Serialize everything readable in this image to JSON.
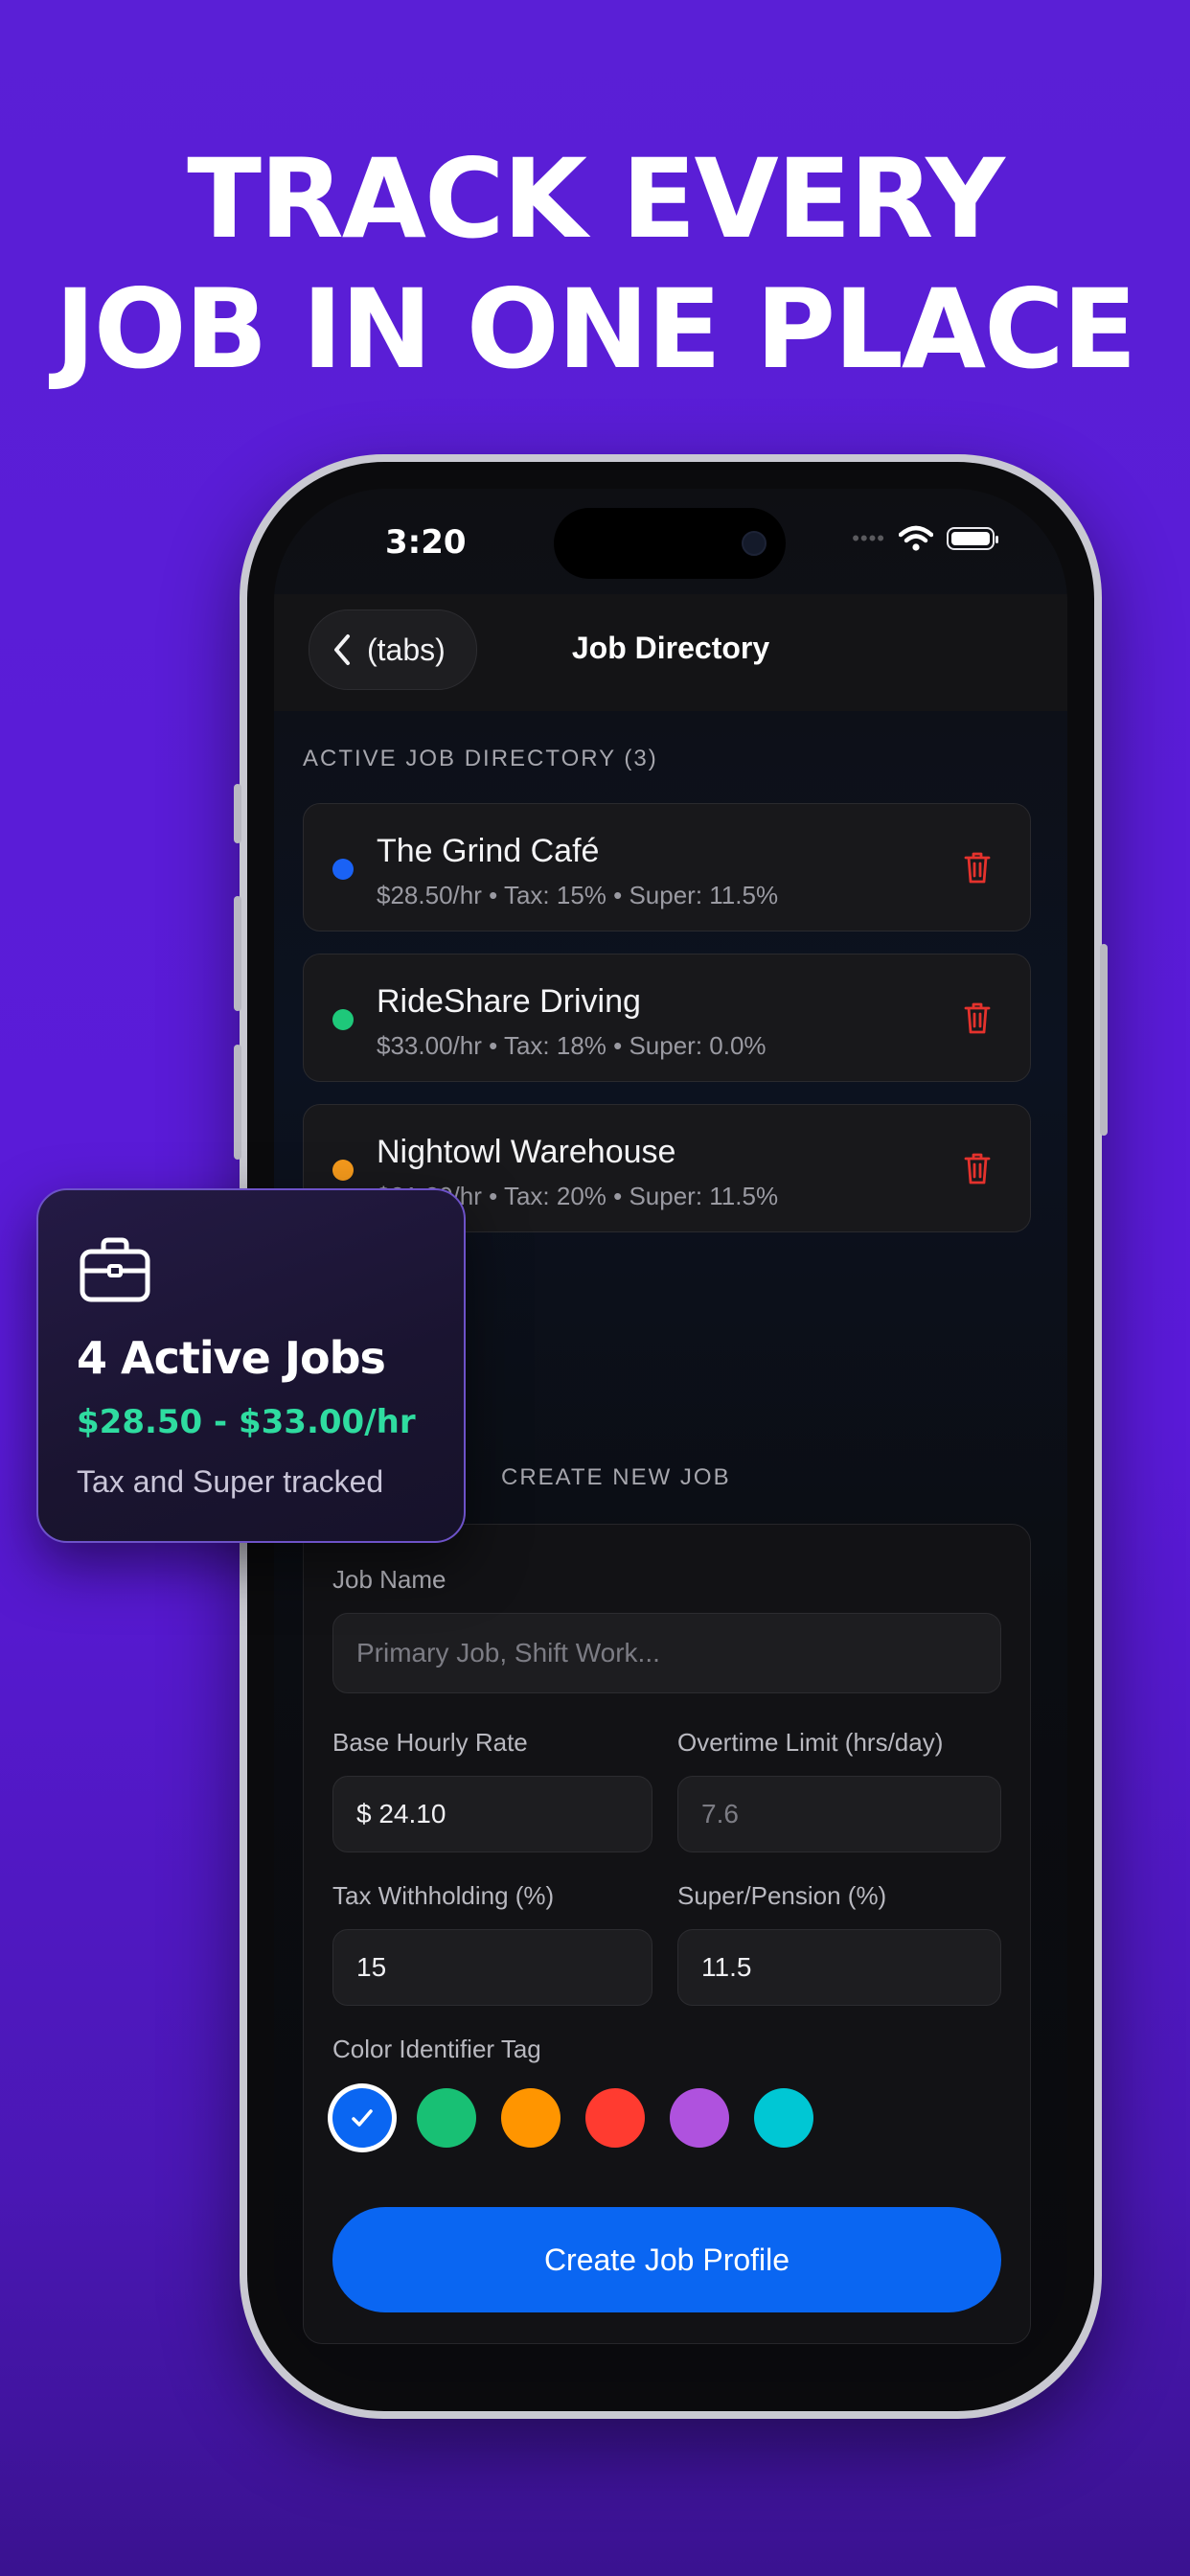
{
  "headline": {
    "line1": "TRACK EVERY",
    "line2": "JOB IN ONE PLACE"
  },
  "status_bar": {
    "time": "3:20",
    "signal": "••••"
  },
  "nav": {
    "back_label": "(tabs)",
    "title": "Job Directory"
  },
  "active_section": {
    "label": "ACTIVE JOB DIRECTORY (3)",
    "jobs": [
      {
        "name": "The Grind Café",
        "meta": "$28.50/hr • Tax: 15% • Super: 11.5%",
        "color": "#1a62f5"
      },
      {
        "name": "RideShare Driving",
        "meta": "$33.00/hr • Tax: 18% • Super: 0.0%",
        "color": "#1ec87a"
      },
      {
        "name": "Nightowl Warehouse",
        "meta": "$31.20/hr • Tax: 20% • Super: 11.5%",
        "color": "#f59a1c"
      }
    ]
  },
  "create_section": {
    "label": "CREATE NEW JOB",
    "job_name_label": "Job Name",
    "job_name_placeholder": "Primary Job, Shift Work...",
    "base_rate_label": "Base Hourly Rate",
    "base_rate_value": "$ 24.10",
    "overtime_label": "Overtime Limit (hrs/day)",
    "overtime_value": "7.6",
    "tax_label": "Tax Withholding (%)",
    "tax_value": "15",
    "super_label": "Super/Pension (%)",
    "super_value": "11.5",
    "color_label": "Color Identifier Tag",
    "colors": [
      "#0a66f2",
      "#18c074",
      "#ff9500",
      "#ff3b30",
      "#af52de",
      "#00c7d4"
    ],
    "selected_color_index": 0,
    "create_button": "Create Job Profile"
  },
  "summary_card": {
    "title": "4 Active Jobs",
    "range": "$28.50 - $33.00/hr",
    "subtitle": "Tax and Super tracked"
  },
  "colors": {
    "background": "#5a1fd6",
    "accent_blue": "#0a66f2",
    "delete_red": "#e5322d",
    "summary_green": "#2fdca0"
  },
  "icons": [
    "chevron-left-icon",
    "wifi-icon",
    "battery-icon",
    "trash-icon",
    "briefcase-icon",
    "checkmark-icon"
  ]
}
